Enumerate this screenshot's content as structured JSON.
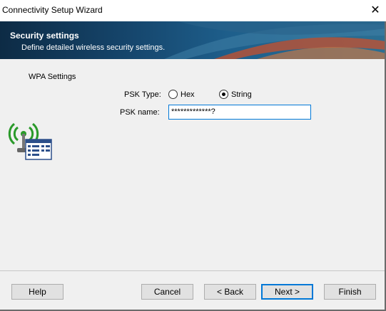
{
  "window": {
    "title": "Connectivity Setup Wizard",
    "close_glyph": "✕"
  },
  "header": {
    "title": "Security settings",
    "subtitle": "Define detailed wireless security settings."
  },
  "wpa": {
    "group_label": "WPA Settings",
    "psk_type_label": "PSK Type:",
    "options": [
      {
        "label": "Hex",
        "selected": false
      },
      {
        "label": "String",
        "selected": true
      }
    ],
    "psk_name_label": "PSK name:",
    "psk_name_value": "*************?"
  },
  "buttons": {
    "help": "Help",
    "cancel": "Cancel",
    "back": "< Back",
    "next": "Next >",
    "finish": "Finish"
  }
}
